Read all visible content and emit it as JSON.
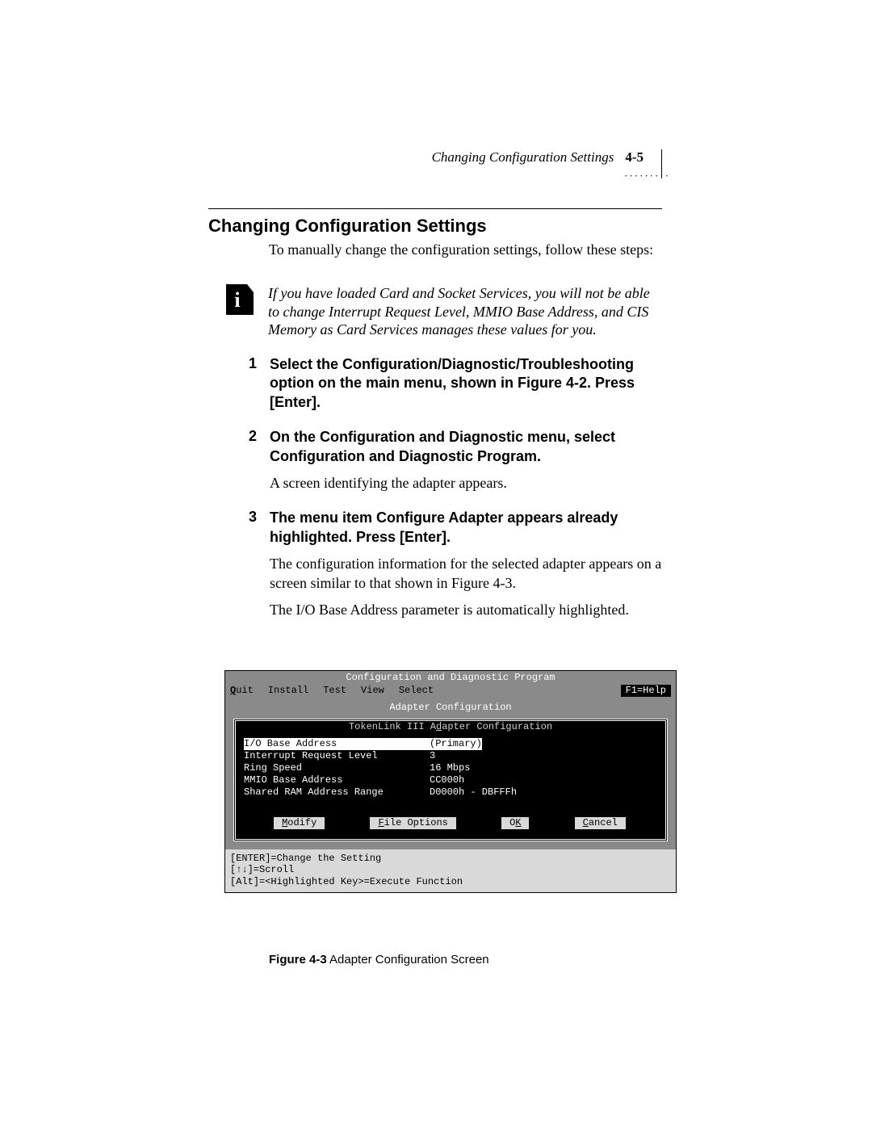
{
  "running_head": {
    "title": "Changing Configuration Settings",
    "page": "4-5"
  },
  "dots": "·········",
  "section_title": "Changing Configuration Settings",
  "intro": "To manually change the configuration settings, follow these steps:",
  "note": "If you have loaded Card and Socket Services, you will not be able to change Interrupt Request Level, MMIO Base Address, and CIS Memory as Card Services manages these values for you.",
  "steps": [
    {
      "num": "1",
      "bold": "Select the Configuration/Diagnostic/Troubleshooting option on the main menu, shown in Figure 4-2. Press [Enter].",
      "paras": []
    },
    {
      "num": "2",
      "bold": "On the Configuration and Diagnostic menu, select Configuration and Diagnostic Program.",
      "paras": [
        "A screen identifying the adapter appears."
      ]
    },
    {
      "num": "3",
      "bold": "The menu item Configure Adapter appears already highlighted. Press [Enter].",
      "paras": [
        "The configuration information for the selected adapter appears on a screen similar to that shown in Figure 4-3.",
        "The I/O Base Address parameter is automatically highlighted."
      ]
    }
  ],
  "terminal": {
    "title": "Configuration and Diagnostic Program",
    "menu": {
      "quit": "Quit",
      "install": "Install",
      "test": "Test",
      "view": "View",
      "select": "Select",
      "help": "F1=Help"
    },
    "subtitle": "Adapter Configuration",
    "inner_title_pre": "TokenLink III A",
    "inner_title_u": "d",
    "inner_title_post": "apter Configuration",
    "rows": [
      {
        "k": "I/O Base Address",
        "v": "(Primary)",
        "hl": true
      },
      {
        "k": "Interrupt Request Level",
        "v": "3",
        "hl": false
      },
      {
        "k": "Ring Speed",
        "v": "16 Mbps",
        "hl": false
      },
      {
        "k": "MMIO Base Address",
        "v": "CC000h",
        "hl": false
      },
      {
        "k": "Shared RAM Address Range",
        "v": "D0000h - DBFFFh",
        "hl": false
      }
    ],
    "buttons": {
      "modify_u": "M",
      "modify_rest": "odify",
      "file_u": "F",
      "file_rest": "ile Options",
      "ok_pre": "O",
      "ok_u": "K",
      "cancel_u": "C",
      "cancel_rest": "ancel"
    },
    "footer": [
      "[ENTER]=Change the Setting",
      "[↑↓]=Scroll",
      "[Alt]=<Highlighted Key>=Execute Function"
    ]
  },
  "caption": {
    "label": "Figure 4-3",
    "text": "  Adapter Configuration Screen"
  }
}
